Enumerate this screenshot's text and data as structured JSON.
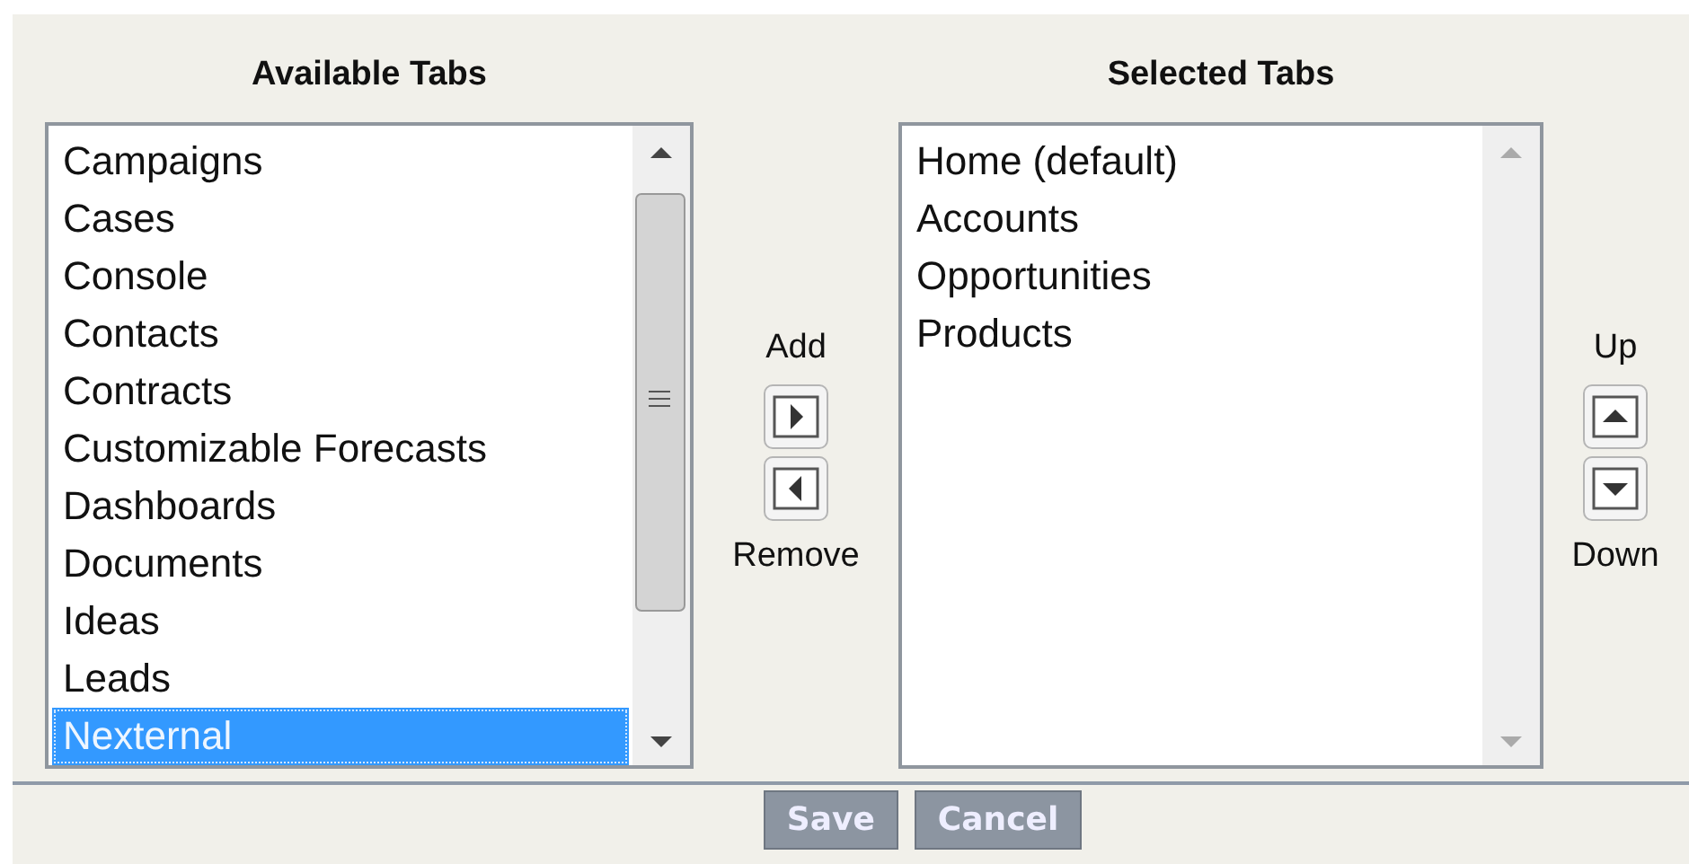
{
  "available": {
    "heading": "Available Tabs",
    "items": [
      {
        "label": "Campaigns",
        "selected": false
      },
      {
        "label": "Cases",
        "selected": false
      },
      {
        "label": "Console",
        "selected": false
      },
      {
        "label": "Contacts",
        "selected": false
      },
      {
        "label": "Contracts",
        "selected": false
      },
      {
        "label": "Customizable Forecasts",
        "selected": false
      },
      {
        "label": "Dashboards",
        "selected": false
      },
      {
        "label": "Documents",
        "selected": false
      },
      {
        "label": "Ideas",
        "selected": false
      },
      {
        "label": "Leads",
        "selected": false
      },
      {
        "label": "Nexternal",
        "selected": true
      }
    ]
  },
  "move_controls": {
    "add_label": "Add",
    "remove_label": "Remove"
  },
  "selected": {
    "heading": "Selected Tabs",
    "items": [
      {
        "label": "Home (default)",
        "selected": false
      },
      {
        "label": "Accounts",
        "selected": false
      },
      {
        "label": "Opportunities",
        "selected": false
      },
      {
        "label": "Products",
        "selected": false
      }
    ]
  },
  "order_controls": {
    "up_label": "Up",
    "down_label": "Down"
  },
  "buttons": [
    "Save",
    "Cancel"
  ]
}
